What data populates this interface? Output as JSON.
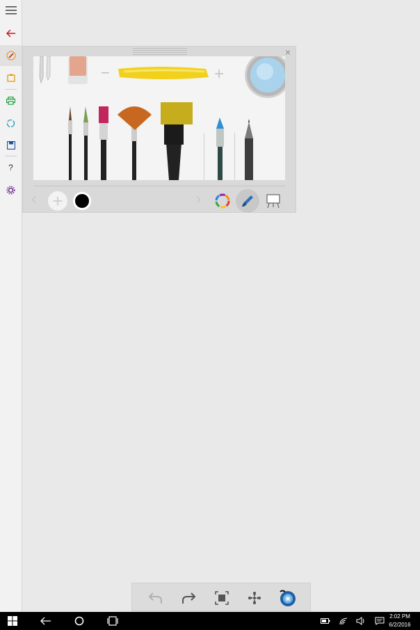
{
  "left_rail": {
    "items": [
      "menu",
      "back",
      "brush-tools",
      "clipboard",
      "print",
      "share",
      "save",
      "help",
      "settings"
    ],
    "help_label": "?"
  },
  "panel": {
    "close_label": "×",
    "size_minus": "−",
    "size_plus": "+",
    "nav_prev": "‹",
    "nav_next": "›",
    "add_label": "+",
    "selected_color": "#000000",
    "accent": "#0078d7"
  },
  "taskbar": {
    "time": "2:02 PM",
    "date": "6/2/2016"
  }
}
